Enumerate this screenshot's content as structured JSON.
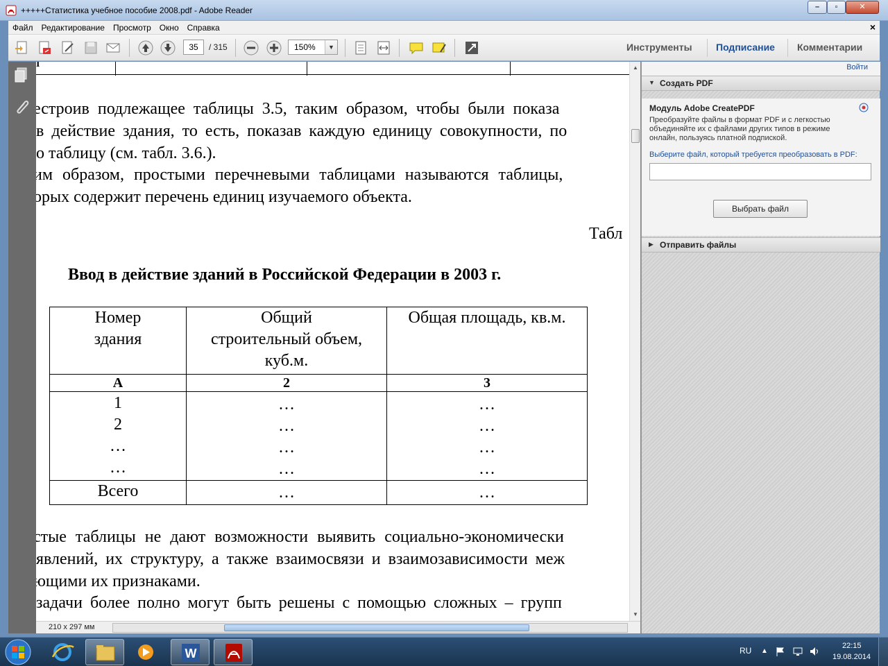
{
  "window": {
    "title": "+++++Статистика учебное пособие 2008.pdf - Adobe Reader",
    "min_icon": "minimize-icon",
    "max_icon": "maximize-icon",
    "close_icon": "close-icon"
  },
  "menu": {
    "items": [
      "Файл",
      "Редактирование",
      "Просмотр",
      "Окно",
      "Справка"
    ],
    "close_label": "×"
  },
  "toolbar": {
    "page_current": "35",
    "page_total": "/ 315",
    "zoom": "150%",
    "tabs": [
      "Инструменты",
      "Подписание",
      "Комментарии"
    ]
  },
  "document": {
    "para1": [
      "естроив подлежащее таблицы 3.5, таким образом, чтобы были показа",
      " в действие здания, то есть, показав каждую единицу совокупности, по",
      "о таблицу (см. табл. 3.6.)."
    ],
    "para2": [
      "им образом, простыми перечневыми таблицами называются таблицы,",
      "орых содержит перечень единиц изучаемого объекта."
    ],
    "table_label": "Табл",
    "table_title": "Ввод в действие зданий в Российской Федерации в 2003 г.",
    "table": {
      "headers": [
        "Номер здания",
        "Общий строительный объем, куб.м.",
        "Общая площадь, кв.м."
      ],
      "header_lines": [
        [
          "Номер",
          "здания"
        ],
        [
          "Общий",
          "строительный объем,",
          "куб.м."
        ],
        [
          "Общая площадь, кв.м."
        ]
      ],
      "index_row": [
        "А",
        "2",
        "3"
      ],
      "body": [
        [
          "1",
          "…",
          "…"
        ],
        [
          "2",
          "…",
          "…"
        ],
        [
          "…",
          "…",
          "…"
        ],
        [
          "…",
          "…",
          "…"
        ]
      ],
      "total_row": [
        "Всего",
        "…",
        "…"
      ]
    },
    "para3": [
      "стые таблицы не дают возможности выявить социально-экономически",
      " явлений, их структуру, а также взаимосвязи и взаимозависимости меж",
      "ющими их признаками."
    ],
    "para4": [
      " задачи более полно могут быть решены с помощью сложных – групп"
    ],
    "top_fragment": "I"
  },
  "status": {
    "page_size": "210 x 297 мм"
  },
  "right_pane": {
    "signin": "Войти",
    "create_pdf_header": "Создать PDF",
    "module_title": "Модуль Adobe CreatePDF",
    "description": "Преобразуйте файлы в формат PDF и с легкостью объединяйте их с файлами других типов в режиме онлайн, пользуясь платной подпиской.",
    "prompt": "Выберите файл, который требуется преобразовать в PDF:",
    "select_button": "Выбрать файл",
    "send_files_header": "Отправить файлы"
  },
  "taskbar": {
    "lang": "RU",
    "time": "22:15",
    "date": "19.08.2014",
    "apps": [
      "windows-start-icon",
      "internet-explorer-icon",
      "file-explorer-icon",
      "media-player-icon",
      "word-icon",
      "adobe-reader-icon"
    ]
  }
}
